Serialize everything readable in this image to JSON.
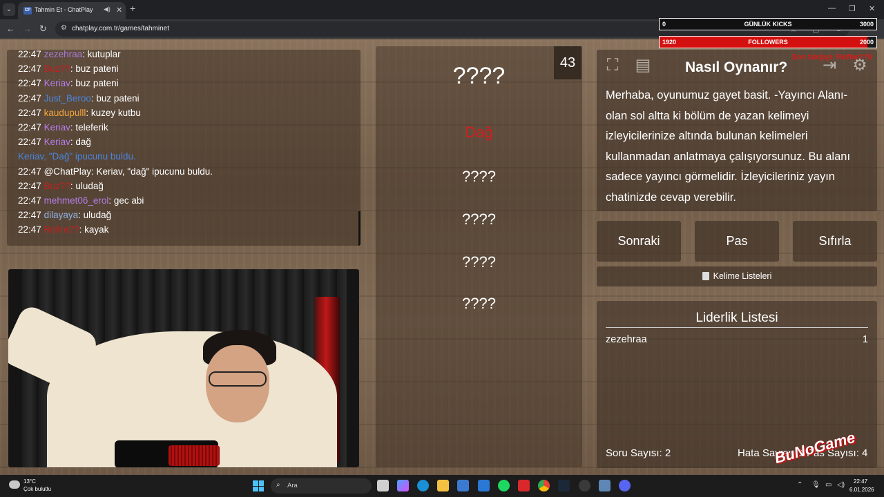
{
  "browser": {
    "tab_title": "Tahmin Et - ChatPlay",
    "tab_favicon": "CP",
    "url": "chatplay.com.tr/games/tahminet"
  },
  "overlay": {
    "kicks": {
      "current": "0",
      "label": "GÜNLÜK KICKS",
      "goal": "3000"
    },
    "followers": {
      "current": "1920",
      "label": "FOLLOWERS",
      "goal": "2000",
      "progress": 0.96
    },
    "alert": "Son takipçi: Rofire??0",
    "accent": "#d40f0f"
  },
  "chat": {
    "messages": [
      {
        "time": "22:47",
        "user": "zezehraa",
        "text": ": kutuplar",
        "color": "#a87bd8"
      },
      {
        "time": "22:47",
        "user": "Buz??",
        "text": ": buz pateni",
        "color": "#c42020"
      },
      {
        "time": "22:47",
        "user": "Keriav",
        "text": ": buz pateni",
        "color": "#b57ce8"
      },
      {
        "time": "22:47",
        "user": "Just_Beroo",
        "text": ": buz pateni",
        "color": "#4a86e0"
      },
      {
        "time": "22:47",
        "user": "kaudupulll",
        "text": ": kuzey kutbu",
        "color": "#f2a43a"
      },
      {
        "time": "22:47",
        "user": "Keriav",
        "text": ": teleferik",
        "color": "#b57ce8"
      },
      {
        "time": "22:47",
        "user": "Keriav",
        "text": ": dağ",
        "color": "#b57ce8"
      },
      {
        "time": "",
        "user": "Keriav, \"Dağ\"",
        "text": " ipucunu buldu.",
        "color": "#4a86e0",
        "system": true
      },
      {
        "time": "22:47",
        "user": "",
        "text": "@ChatPlay: Keriav, \"dağ\" ipucunu buldu.",
        "color": "#ffffff"
      },
      {
        "time": "22:47",
        "user": "Buz??",
        "text": ": uludağ",
        "color": "#c42020"
      },
      {
        "time": "22:47",
        "user": "mehmet06_erol",
        "text": ": gec abi",
        "color": "#b57ce8"
      },
      {
        "time": "22:47",
        "user": "dilayaya",
        "text": ": uludağ",
        "color": "#8fb4e8"
      },
      {
        "time": "22:47",
        "user": "Rofire??",
        "text": ": kayak",
        "color": "#c42020"
      }
    ]
  },
  "game": {
    "counter": "43",
    "main_word": "????",
    "words": [
      {
        "text": "Dağ",
        "found": true
      },
      {
        "text": "????",
        "found": false
      },
      {
        "text": "????",
        "found": false
      },
      {
        "text": "????",
        "found": false
      },
      {
        "text": "????",
        "found": false
      }
    ]
  },
  "howto": {
    "title": "Nasıl Oynanır?",
    "text": "Merhaba, oyunumuz gayet basit. -Yayıncı Alanı- olan sol altta ki bölüm de yazan kelimeyi izleyicilerinize altında bulunan kelimeleri kullanmadan anlatmaya çalışıyorsunuz. Bu alanı sadece yayıncı görmelidir. İzleyicileriniz yayın chatinizde cevap verebilir.",
    "icons": [
      "fullscreen-icon",
      "notes-icon",
      "logout-icon",
      "settings-icon"
    ]
  },
  "actions": {
    "next": "Sonraki",
    "pass": "Pas",
    "reset": "Sıfırla",
    "word_lists": "Kelime Listeleri"
  },
  "leaderboard": {
    "title": "Liderlik Listesi",
    "rows": [
      {
        "name": "zezehraa",
        "score": "1"
      }
    ],
    "questions": "Soru Sayısı: 2",
    "errors": "Hata Sayısı: 0",
    "passes": "Pas Sayısı: 4"
  },
  "branding": {
    "logo": "BuNoGame"
  },
  "taskbar": {
    "temp": "13°C",
    "weather": "Çok bulutlu",
    "search_placeholder": "Ara",
    "time": "22:47",
    "date": "6.01.2026"
  }
}
